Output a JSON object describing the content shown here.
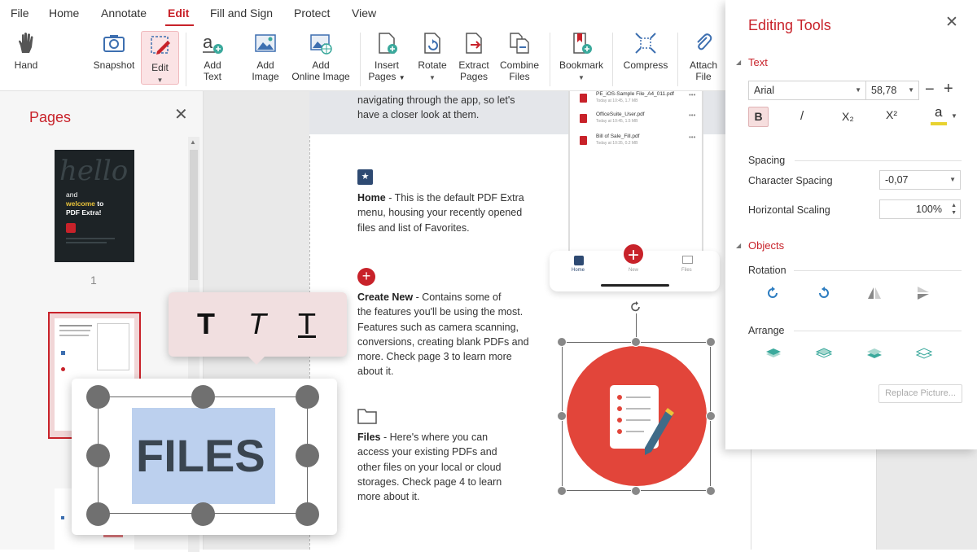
{
  "menu": {
    "items": [
      "File",
      "Home",
      "Annotate",
      "Edit",
      "Fill and Sign",
      "Protect",
      "View"
    ],
    "active": "Edit"
  },
  "ribbon": {
    "hand": "Hand",
    "snapshot": "Snapshot",
    "edit": "Edit",
    "add_text_1": "Add",
    "add_text_2": "Text",
    "add_image_1": "Add",
    "add_image_2": "Image",
    "add_online_1": "Add",
    "add_online_2": "Online Image",
    "insert_1": "Insert",
    "insert_2": "Pages",
    "rotate": "Rotate",
    "extract_1": "Extract",
    "extract_2": "Pages",
    "combine_1": "Combine",
    "combine_2": "Files",
    "bookmark": "Bookmark",
    "compress": "Compress",
    "attach_1": "Attach",
    "attach_2": "File"
  },
  "pages_panel": {
    "title": "Pages",
    "page1_number": "1",
    "thumb1_lines": [
      "and",
      "welcome",
      "to",
      "PDF Extra!"
    ]
  },
  "document": {
    "intro_1": "navigating through the app, so let's",
    "intro_2": "have a closer look at them.",
    "home_title": "Home",
    "home_lines": [
      " - This is the default PDF Extra",
      "menu, housing your recently opened",
      "files and list of Favorites."
    ],
    "create_title": "Create New",
    "create_lines": [
      " - Contains some of",
      "the features you'll be using the most.",
      "Features such as camera scanning,",
      "conversions, creating blank PDFs and",
      "more. Check page 3 to learn more",
      "about it."
    ],
    "files_title": "Files",
    "files_lines": [
      " - Here's where you can",
      "access your existing PDFs and",
      "other files on your local or cloud",
      "storages. Check page 4 to learn",
      "more about it."
    ]
  },
  "phone": {
    "files": [
      {
        "name": "PE_iOS-Sample File_A4_011.pdf",
        "meta": "Today at 10:45, 1.7 MB"
      },
      {
        "name": "OfficeSuite_User.pdf",
        "meta": "Today at 10:45, 1.5 MB"
      },
      {
        "name": "Bill of Sale_Fill.pdf",
        "meta": "Today at 10:35, 0.2 MB"
      }
    ],
    "nav_home": "Home",
    "nav_new": "New",
    "nav_files": "Files"
  },
  "popup": {
    "bold_glyph": "T",
    "italic_glyph": "T",
    "underline_glyph": "T",
    "files_text": "FILES"
  },
  "editing_tools": {
    "title": "Editing Tools",
    "text_section": "Text",
    "font": "Arial",
    "font_size": "58,78",
    "bold": "B",
    "italic": "/",
    "subscript": "X₂",
    "superscript": "X²",
    "color_letter": "a",
    "spacing_heading": "Spacing",
    "char_spacing_label": "Character Spacing",
    "char_spacing_value": "-0,07",
    "h_scaling_label": "Horizontal Scaling",
    "h_scaling_value": "100%",
    "objects_section": "Objects",
    "rotation_heading": "Rotation",
    "arrange_heading": "Arrange",
    "replace_button": "Replace Picture..."
  },
  "colors": {
    "accent": "#c8222a",
    "teal": "#3ba99c",
    "selection": "#bcd0ee"
  }
}
